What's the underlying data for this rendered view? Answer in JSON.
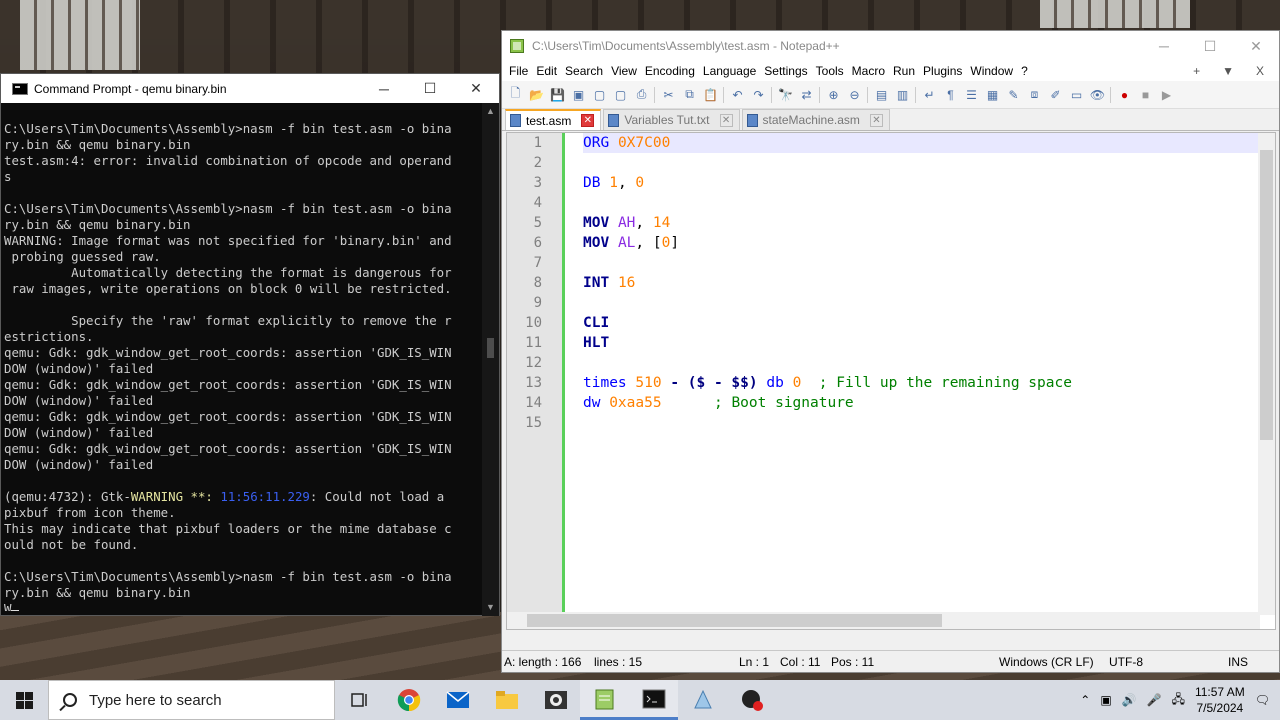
{
  "cmd": {
    "title": "Command Prompt - qemu  binary.bin",
    "output": [
      "C:\\Users\\Tim\\Documents\\Assembly>nasm -f bin test.asm -o bina",
      "ry.bin && qemu binary.bin",
      "test.asm:4: error: invalid combination of opcode and operand",
      "s",
      "",
      "C:\\Users\\Tim\\Documents\\Assembly>nasm -f bin test.asm -o bina",
      "ry.bin && qemu binary.bin",
      "WARNING: Image format was not specified for 'binary.bin' and",
      " probing guessed raw.",
      "         Automatically detecting the format is dangerous for",
      " raw images, write operations on block 0 will be restricted.",
      "",
      "         Specify the 'raw' format explicitly to remove the r",
      "estrictions.",
      "qemu: Gdk: gdk_window_get_root_coords: assertion 'GDK_IS_WIN",
      "DOW (window)' failed",
      "qemu: Gdk: gdk_window_get_root_coords: assertion 'GDK_IS_WIN",
      "DOW (window)' failed",
      "qemu: Gdk: gdk_window_get_root_coords: assertion 'GDK_IS_WIN",
      "DOW (window)' failed",
      "qemu: Gdk: gdk_window_get_root_coords: assertion 'GDK_IS_WIN",
      "DOW (window)' failed",
      ""
    ],
    "gtk_line_prefix": "(qemu:4732): Gtk-",
    "gtk_warning": "WARNING **:",
    "gtk_timestamp": "11:56:11.229",
    "gtk_line_suffix": ": Could not load a",
    "output_tail": [
      "pixbuf from icon theme.",
      "This may indicate that pixbuf loaders or the mime database c",
      "ould not be found.",
      "",
      "C:\\Users\\Tim\\Documents\\Assembly>nasm -f bin test.asm -o bina",
      "ry.bin && qemu binary.bin"
    ],
    "last_line": "W"
  },
  "npp": {
    "title": "C:\\Users\\Tim\\Documents\\Assembly\\test.asm - Notepad++",
    "menu": [
      "File",
      "Edit",
      "Search",
      "View",
      "Encoding",
      "Language",
      "Settings",
      "Tools",
      "Macro",
      "Run",
      "Plugins",
      "Window",
      "?"
    ],
    "menu_right": [
      "+",
      "▼",
      "X"
    ],
    "tabs": [
      {
        "label": "test.asm"
      },
      {
        "label": "Variables Tut.txt"
      },
      {
        "label": "stateMachine.asm"
      }
    ],
    "line_numbers": [
      "1",
      "2",
      "3",
      "4",
      "5",
      "6",
      "7",
      "8",
      "9",
      "10",
      "11",
      "12",
      "13",
      "14",
      "15"
    ],
    "code": {
      "l1_kw": "ORG",
      "l1_num": "0X7C00",
      "l3_kw": "DB",
      "l3_num1": "1",
      "l3_comma": ",",
      "l3_num2": "0",
      "l5_kw": "MOV",
      "l5_reg": "AH",
      "l5_comma": ",",
      "l5_num": "14",
      "l6_kw": "MOV",
      "l6_reg": "AL",
      "l6_comma": ",",
      "l6_lb": "[",
      "l6_num": "0",
      "l6_rb": "]",
      "l8_kw": "INT",
      "l8_num": "16",
      "l10_kw": "CLI",
      "l11_kw": "HLT",
      "l13_kw": "times",
      "l13_num": "510",
      "l13_expr": "- ($ - $$)",
      "l13_db": "db",
      "l13_num2": "0",
      "l13_cmt": "; Fill up the remaining space",
      "l14_kw": "dw",
      "l14_num": "0xaa55",
      "l14_cmt": "; Boot signature"
    },
    "status": {
      "length": "A: length : 166",
      "lines": "lines : 15",
      "ln": "Ln : 1",
      "col": "Col : 11",
      "pos": "Pos : 11",
      "eol": "Windows (CR LF)",
      "encoding": "UTF-8",
      "mode": "INS"
    }
  },
  "taskbar": {
    "search_placeholder": "Type here to search",
    "time": "11:57 AM",
    "date": "7/5/2024"
  }
}
